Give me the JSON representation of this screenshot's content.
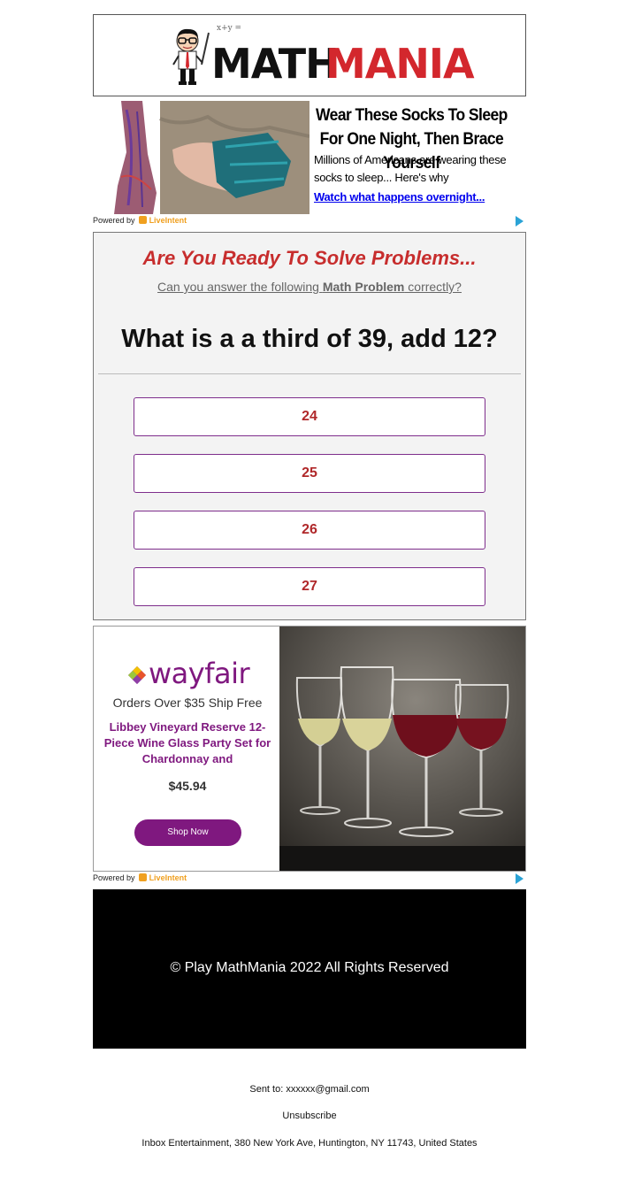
{
  "header": {
    "logo_math": "MATH",
    "logo_mania": "MANIA",
    "formula": "x+y ="
  },
  "ad_top": {
    "title": "Wear These Socks To Sleep For One Night, Then Brace Yourself",
    "body": "Millions of Americans are wearing these socks to sleep... Here's why",
    "link": "Watch what happens overnight...",
    "powered_by": "Powered by",
    "powered_brand": "LiveIntent"
  },
  "quiz": {
    "heading": "Are You Ready To Solve Problems...",
    "sub_prefix": "Can you answer the following ",
    "sub_bold": "Math Problem",
    "sub_suffix": " correctly?",
    "question": "What is a a third of 39, add 12?",
    "answers": [
      "24",
      "25",
      "26",
      "27"
    ]
  },
  "ad_bottom": {
    "brand": "wayfair",
    "shipping": "Orders Over $35 Ship Free",
    "product": "Libbey Vineyard Reserve 12-Piece Wine Glass Party Set for Chardonnay and",
    "price": "$45.94",
    "cta": "Shop Now",
    "powered_by": "Powered by",
    "powered_brand": "LiveIntent"
  },
  "footer": {
    "copyright": "© Play MathMania 2022 All Rights Reserved",
    "sent_to_label": "Sent to:",
    "sent_to_email": "xxxxxx@gmail.com",
    "unsubscribe": "Unsubscribe",
    "address": "Inbox Entertainment, 380 New York Ave, Huntington, NY 11743, United States"
  },
  "colors": {
    "brand_red": "#d3272d",
    "quiz_red": "#c72d2d",
    "answer_border": "#7e2e8c",
    "wayfair_purple": "#7f187f",
    "link_blue": "#0000ee",
    "adchoices_blue": "#2aa3d6"
  }
}
